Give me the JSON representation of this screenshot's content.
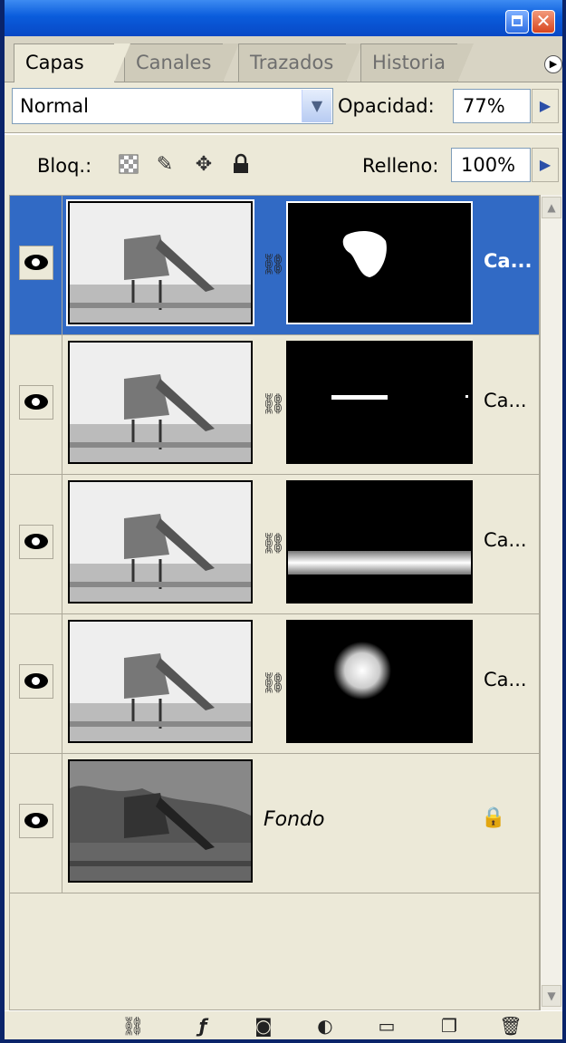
{
  "tabs": [
    {
      "label": "Capas",
      "active": true
    },
    {
      "label": "Canales",
      "active": false
    },
    {
      "label": "Trazados",
      "active": false
    },
    {
      "label": "Historia",
      "active": false
    }
  ],
  "blend_mode": "Normal",
  "opacity": {
    "label": "Opacidad:",
    "value": "77%"
  },
  "lock": {
    "label": "Bloq.:"
  },
  "fill": {
    "label": "Relleno:",
    "value": "100%"
  },
  "layers": [
    {
      "name": "Ca...",
      "selected": true,
      "mask": "blob"
    },
    {
      "name": "Ca...",
      "selected": false,
      "mask": "line"
    },
    {
      "name": "Ca...",
      "selected": false,
      "mask": "band"
    },
    {
      "name": "Ca...",
      "selected": false,
      "mask": "spot"
    },
    {
      "name": "Fondo",
      "selected": false,
      "locked": true
    }
  ],
  "colors": {
    "titlebar": "#0A5CDC",
    "panel": "#ECE9D8",
    "selection": "#316AC5"
  },
  "icons": [
    "minimize-icon",
    "close-icon",
    "panel-menu-icon",
    "lock-transparency-icon",
    "lock-image-icon",
    "lock-position-icon",
    "lock-all-icon",
    "eye-icon",
    "link-icon",
    "padlock-icon",
    "link-layers-icon",
    "layer-style-icon",
    "add-mask-icon",
    "adjustment-layer-icon",
    "new-group-icon",
    "new-layer-icon",
    "trash-icon"
  ]
}
